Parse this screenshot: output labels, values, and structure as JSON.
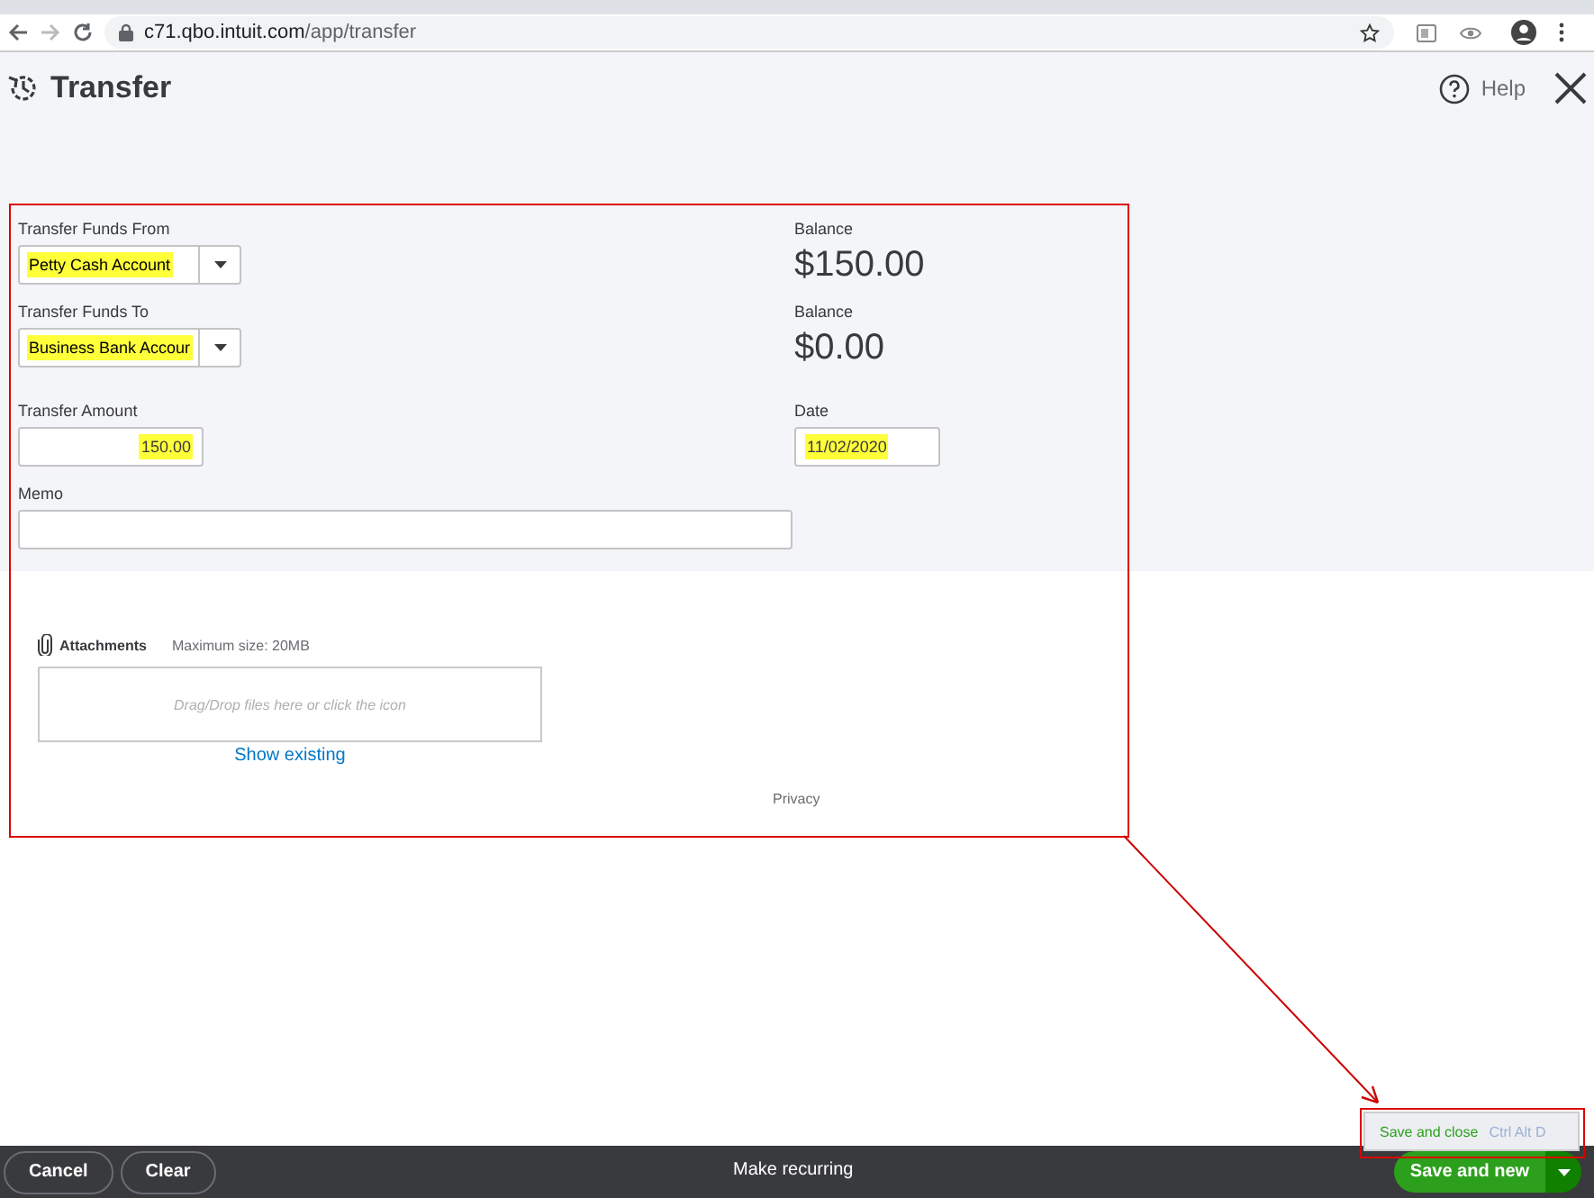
{
  "browser": {
    "url_host": "c71.qbo.intuit.com",
    "url_path": "/app/transfer"
  },
  "header": {
    "title": "Transfer",
    "help": "Help"
  },
  "form": {
    "left": [
      {
        "kind": "select",
        "label": "Transfer Funds From",
        "value": "Petty Cash Account",
        "highlighted": true
      },
      {
        "kind": "select",
        "label": "Transfer Funds To",
        "value": "Business Bank Accour",
        "highlighted": true
      },
      {
        "kind": "amount",
        "label": "Transfer Amount",
        "value": "150.00",
        "highlighted": true
      },
      {
        "kind": "memo",
        "label": "Memo"
      }
    ],
    "right": [
      {
        "kind": "balance",
        "label": "Balance",
        "value": "$150.00"
      },
      {
        "kind": "balance",
        "label": "Balance",
        "value": "$0.00"
      },
      {
        "kind": "date",
        "label": "Date",
        "value": "11/02/2020",
        "highlighted": true
      }
    ]
  },
  "attachments": {
    "title": "Attachments",
    "max_size": "Maximum size: 20MB",
    "drop_hint": "Drag/Drop files here or click the icon",
    "show_existing": "Show existing"
  },
  "privacy": "Privacy",
  "footer": {
    "cancel": "Cancel",
    "clear": "Clear",
    "make_recurring": "Make recurring",
    "save": "Save and new"
  },
  "save_menu": {
    "label": "Save and close",
    "shortcut": "Ctrl Alt D"
  }
}
